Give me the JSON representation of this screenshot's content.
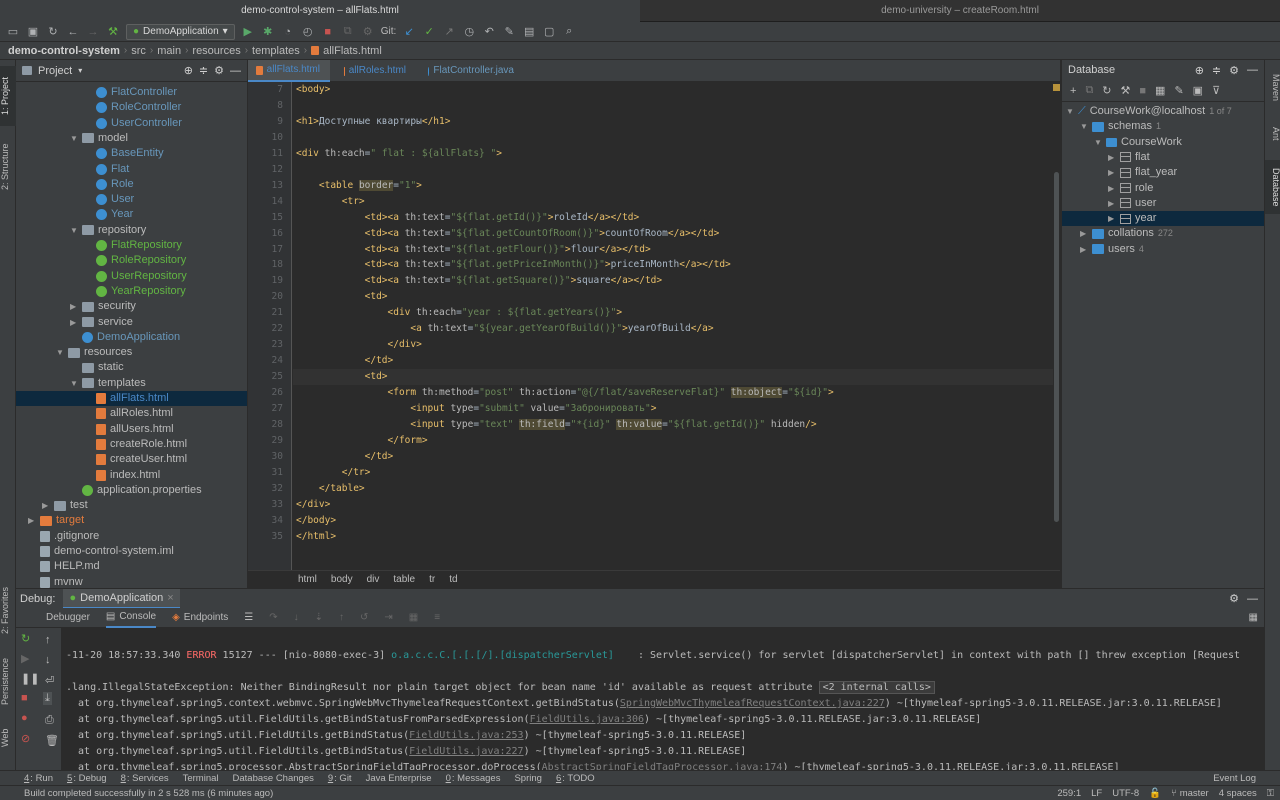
{
  "window": {
    "title_active": "demo-control-system – allFlats.html",
    "title_inactive": "demo-university – createRoom.html"
  },
  "toolbar": {
    "run_config": "DemoApplication",
    "git_label": "Git:"
  },
  "breadcrumbs": [
    "demo-control-system",
    "src",
    "main",
    "resources",
    "templates",
    "allFlats.html"
  ],
  "project_panel": {
    "title": "Project",
    "items": [
      {
        "label": "FlatController",
        "kind": "class",
        "depth": 4
      },
      {
        "label": "RoleController",
        "kind": "class",
        "depth": 4
      },
      {
        "label": "UserController",
        "kind": "class",
        "depth": 4
      },
      {
        "label": "model",
        "kind": "package",
        "depth": 3,
        "expanded": true
      },
      {
        "label": "BaseEntity",
        "kind": "class",
        "depth": 4
      },
      {
        "label": "Flat",
        "kind": "class",
        "depth": 4
      },
      {
        "label": "Role",
        "kind": "class",
        "depth": 4
      },
      {
        "label": "User",
        "kind": "class",
        "depth": 4
      },
      {
        "label": "Year",
        "kind": "class",
        "depth": 4
      },
      {
        "label": "repository",
        "kind": "package",
        "depth": 3,
        "expanded": true
      },
      {
        "label": "FlatRepository",
        "kind": "interface",
        "depth": 4
      },
      {
        "label": "RoleRepository",
        "kind": "interface",
        "depth": 4
      },
      {
        "label": "UserRepository",
        "kind": "interface",
        "depth": 4
      },
      {
        "label": "YearRepository",
        "kind": "interface",
        "depth": 4
      },
      {
        "label": "security",
        "kind": "package",
        "depth": 3,
        "expanded": false
      },
      {
        "label": "service",
        "kind": "package",
        "depth": 3,
        "expanded": false
      },
      {
        "label": "DemoApplication",
        "kind": "class",
        "depth": 3
      },
      {
        "label": "resources",
        "kind": "folder",
        "depth": 2,
        "expanded": true
      },
      {
        "label": "static",
        "kind": "folder",
        "depth": 3
      },
      {
        "label": "templates",
        "kind": "folder",
        "depth": 3,
        "expanded": true
      },
      {
        "label": "allFlats.html",
        "kind": "html",
        "depth": 4,
        "selected": true
      },
      {
        "label": "allRoles.html",
        "kind": "html",
        "depth": 4
      },
      {
        "label": "allUsers.html",
        "kind": "html",
        "depth": 4
      },
      {
        "label": "createRole.html",
        "kind": "html",
        "depth": 4
      },
      {
        "label": "createUser.html",
        "kind": "html",
        "depth": 4
      },
      {
        "label": "index.html",
        "kind": "html",
        "depth": 4
      },
      {
        "label": "application.properties",
        "kind": "props",
        "depth": 3
      },
      {
        "label": "test",
        "kind": "folder",
        "depth": 1,
        "expanded": false
      },
      {
        "label": "target",
        "kind": "excluded",
        "depth": 0,
        "expanded": false
      },
      {
        "label": ".gitignore",
        "kind": "file",
        "depth": 0
      },
      {
        "label": "demo-control-system.iml",
        "kind": "iml",
        "depth": 0
      },
      {
        "label": "HELP.md",
        "kind": "md",
        "depth": 0
      },
      {
        "label": "mvnw",
        "kind": "file",
        "depth": 0
      }
    ]
  },
  "editor": {
    "tabs": [
      {
        "label": "allFlats.html",
        "active": true
      },
      {
        "label": "allRoles.html",
        "active": false
      },
      {
        "label": "FlatController.java",
        "active": false
      }
    ],
    "first_line": 7,
    "current_line": 25,
    "lines": [
      [
        [
          "t",
          "<body>"
        ]
      ],
      [],
      [
        [
          "t",
          "<h1>"
        ],
        [
          "x",
          "Доступные квартиры"
        ],
        [
          "t",
          "</h1>"
        ]
      ],
      [],
      [
        [
          "t",
          "<div "
        ],
        [
          "a",
          "th:each"
        ],
        [
          "x",
          "="
        ],
        [
          "s",
          "\" flat : ${allFlats} \""
        ],
        [
          "t",
          ">"
        ]
      ],
      [],
      [
        [
          "x",
          "    "
        ],
        [
          "t",
          "<table "
        ],
        [
          "h",
          "border"
        ],
        [
          "x",
          "="
        ],
        [
          "s",
          "\"1\""
        ],
        [
          "t",
          ">"
        ]
      ],
      [
        [
          "x",
          "        "
        ],
        [
          "t",
          "<tr>"
        ]
      ],
      [
        [
          "x",
          "            "
        ],
        [
          "t",
          "<td><a "
        ],
        [
          "a",
          "th:text"
        ],
        [
          "x",
          "="
        ],
        [
          "s",
          "\"${flat.getId()}\""
        ],
        [
          "t",
          ">"
        ],
        [
          "x",
          "roleId"
        ],
        [
          "t",
          "</a></td>"
        ]
      ],
      [
        [
          "x",
          "            "
        ],
        [
          "t",
          "<td><a "
        ],
        [
          "a",
          "th:text"
        ],
        [
          "x",
          "="
        ],
        [
          "s",
          "\"${flat.getCountOfRoom()}\""
        ],
        [
          "t",
          ">"
        ],
        [
          "x",
          "countOfRoom"
        ],
        [
          "t",
          "</a></td>"
        ]
      ],
      [
        [
          "x",
          "            "
        ],
        [
          "t",
          "<td><a "
        ],
        [
          "a",
          "th:text"
        ],
        [
          "x",
          "="
        ],
        [
          "s",
          "\"${flat.getFlour()}\""
        ],
        [
          "t",
          ">"
        ],
        [
          "x",
          "flour"
        ],
        [
          "t",
          "</a></td>"
        ]
      ],
      [
        [
          "x",
          "            "
        ],
        [
          "t",
          "<td><a "
        ],
        [
          "a",
          "th:text"
        ],
        [
          "x",
          "="
        ],
        [
          "s",
          "\"${flat.getPriceInMonth()}\""
        ],
        [
          "t",
          ">"
        ],
        [
          "x",
          "priceInMonth"
        ],
        [
          "t",
          "</a></td>"
        ]
      ],
      [
        [
          "x",
          "            "
        ],
        [
          "t",
          "<td><a "
        ],
        [
          "a",
          "th:text"
        ],
        [
          "x",
          "="
        ],
        [
          "s",
          "\"${flat.getSquare()}\""
        ],
        [
          "t",
          ">"
        ],
        [
          "x",
          "square"
        ],
        [
          "t",
          "</a></td>"
        ]
      ],
      [
        [
          "x",
          "            "
        ],
        [
          "t",
          "<td>"
        ]
      ],
      [
        [
          "x",
          "                "
        ],
        [
          "t",
          "<div "
        ],
        [
          "a",
          "th:each"
        ],
        [
          "x",
          "="
        ],
        [
          "s",
          "\"year : ${flat.getYears()}\""
        ],
        [
          "t",
          ">"
        ]
      ],
      [
        [
          "x",
          "                    "
        ],
        [
          "t",
          "<a "
        ],
        [
          "a",
          "th:text"
        ],
        [
          "x",
          "="
        ],
        [
          "s",
          "\"${year.getYearOfBuild()}\""
        ],
        [
          "t",
          ">"
        ],
        [
          "x",
          "yearOfBuild"
        ],
        [
          "t",
          "</a>"
        ]
      ],
      [
        [
          "x",
          "                "
        ],
        [
          "t",
          "</div>"
        ]
      ],
      [
        [
          "x",
          "            "
        ],
        [
          "t",
          "</td>"
        ]
      ],
      [
        [
          "x",
          "            "
        ],
        [
          "t",
          "<td>"
        ]
      ],
      [
        [
          "x",
          "                "
        ],
        [
          "t",
          "<form "
        ],
        [
          "a",
          "th:method"
        ],
        [
          "x",
          "="
        ],
        [
          "s",
          "\"post\" "
        ],
        [
          "a",
          "th:action"
        ],
        [
          "x",
          "="
        ],
        [
          "s",
          "\"@{/flat/saveReserveFlat}\" "
        ],
        [
          "h",
          "th:object"
        ],
        [
          "x",
          "="
        ],
        [
          "s",
          "\"${id}\""
        ],
        [
          "t",
          ">"
        ]
      ],
      [
        [
          "x",
          "                    "
        ],
        [
          "t",
          "<input "
        ],
        [
          "a",
          "type"
        ],
        [
          "x",
          "="
        ],
        [
          "s",
          "\"submit\" "
        ],
        [
          "a",
          "value"
        ],
        [
          "x",
          "="
        ],
        [
          "s",
          "\"Забронировать\""
        ],
        [
          "t",
          ">"
        ]
      ],
      [
        [
          "x",
          "                    "
        ],
        [
          "t",
          "<input "
        ],
        [
          "a",
          "type"
        ],
        [
          "x",
          "="
        ],
        [
          "s",
          "\"text\" "
        ],
        [
          "h",
          "th:field"
        ],
        [
          "x",
          "="
        ],
        [
          "s",
          "\"*{id}\" "
        ],
        [
          "h",
          "th:value"
        ],
        [
          "x",
          "="
        ],
        [
          "s",
          "\"${flat.getId()}\" "
        ],
        [
          "a",
          "hidden"
        ],
        [
          "t",
          "/>"
        ]
      ],
      [
        [
          "x",
          "                "
        ],
        [
          "t",
          "</form>"
        ]
      ],
      [
        [
          "x",
          "            "
        ],
        [
          "t",
          "</td>"
        ]
      ],
      [
        [
          "x",
          "        "
        ],
        [
          "t",
          "</tr>"
        ]
      ],
      [
        [
          "x",
          "    "
        ],
        [
          "t",
          "</table>"
        ]
      ],
      [
        [
          "t",
          "</div>"
        ]
      ],
      [
        [
          "t",
          "</body>"
        ]
      ],
      [
        [
          "t",
          "</html>"
        ]
      ]
    ],
    "crumbs": [
      "html",
      "body",
      "div",
      "table",
      "tr",
      "td"
    ]
  },
  "database_panel": {
    "title": "Database",
    "items": [
      {
        "label": "CourseWork@localhost",
        "count": "1 of 7",
        "kind": "datasource",
        "depth": 0
      },
      {
        "label": "schemas",
        "count": "1",
        "kind": "folder",
        "depth": 1
      },
      {
        "label": "CourseWork",
        "count": "",
        "kind": "schema",
        "depth": 2
      },
      {
        "label": "flat",
        "count": "",
        "kind": "table",
        "depth": 3
      },
      {
        "label": "flat_year",
        "count": "",
        "kind": "table",
        "depth": 3
      },
      {
        "label": "role",
        "count": "",
        "kind": "table",
        "depth": 3
      },
      {
        "label": "user",
        "count": "",
        "kind": "table",
        "depth": 3
      },
      {
        "label": "year",
        "count": "",
        "kind": "table",
        "depth": 3,
        "selected": true
      },
      {
        "label": "collations",
        "count": "272",
        "kind": "folder",
        "depth": 1
      },
      {
        "label": "users",
        "count": "4",
        "kind": "folder",
        "depth": 1
      }
    ]
  },
  "left_stripe": [
    "1: Project",
    "2: Structure",
    "2: Favorites",
    "Persistence",
    "Web"
  ],
  "right_stripe": [
    "Maven",
    "Ant",
    "Database"
  ],
  "debug": {
    "label": "Debug:",
    "session": "DemoApplication",
    "tabs": [
      "Debugger",
      "Console",
      "Endpoints"
    ],
    "console": [
      [
        [
          "x",
          "-11-20 18:57:33.340 "
        ],
        [
          "e",
          "ERROR"
        ],
        [
          "x",
          " 15127 --- [nio-8080-exec-3] "
        ],
        [
          "c",
          "o.a.c.c.C.[.[.[/].[dispatcherServlet]"
        ],
        [
          "x",
          "    : Servlet.service() for servlet [dispatcherServlet] in context with path [] threw exception [Request"
        ]
      ],
      [],
      [
        [
          "x",
          ".lang.IllegalStateException: Neither BindingResult nor plain target object for bean name 'id' available as request attribute "
        ],
        [
          "f",
          "<2 internal calls>"
        ]
      ],
      [
        [
          "x",
          "  at org.thymeleaf.spring5.context.webmvc.SpringWebMvcThymeleafRequestContext.getBindStatus("
        ],
        [
          "l",
          "SpringWebMvcThymeleafRequestContext.java:227"
        ],
        [
          "x",
          ") ~[thymeleaf-spring5-3.0.11.RELEASE.jar:3.0.11.RELEASE]"
        ]
      ],
      [
        [
          "x",
          "  at org.thymeleaf.spring5.util.FieldUtils.getBindStatusFromParsedExpression("
        ],
        [
          "l",
          "FieldUtils.java:306"
        ],
        [
          "x",
          ") ~[thymeleaf-spring5-3.0.11.RELEASE.jar:3.0.11.RELEASE]"
        ]
      ],
      [
        [
          "x",
          "  at org.thymeleaf.spring5.util.FieldUtils.getBindStatus("
        ],
        [
          "l",
          "FieldUtils.java:253"
        ],
        [
          "x",
          ") ~[thymeleaf-spring5-3.0.11.RELEASE]"
        ]
      ],
      [
        [
          "x",
          "  at org.thymeleaf.spring5.util.FieldUtils.getBindStatus("
        ],
        [
          "l",
          "FieldUtils.java:227"
        ],
        [
          "x",
          ") ~[thymeleaf-spring5-3.0.11.RELEASE]"
        ]
      ],
      [
        [
          "x",
          "  at org.thymeleaf.spring5.processor.AbstractSpringFieldTagProcessor.doProcess("
        ],
        [
          "l",
          "AbstractSpringFieldTagProcessor.java:174"
        ],
        [
          "x",
          ") ~[thymeleaf-spring5-3.0.11.RELEASE.jar:3.0.11.RELEASE]"
        ]
      ]
    ]
  },
  "tool_windows": [
    {
      "num": "4",
      "label": ": Run"
    },
    {
      "num": "5",
      "label": ": Debug"
    },
    {
      "num": "8",
      "label": ": Services"
    },
    {
      "num": "",
      "label": "Terminal"
    },
    {
      "num": "",
      "label": "Database Changes"
    },
    {
      "num": "9",
      "label": ": Git"
    },
    {
      "num": "",
      "label": "Java Enterprise"
    },
    {
      "num": "0",
      "label": ": Messages"
    },
    {
      "num": "",
      "label": "Spring"
    },
    {
      "num": "6",
      "label": ": TODO"
    }
  ],
  "event_log": "Event Log",
  "status": {
    "message": "Build completed successfully in 2 s 528 ms (6 minutes ago)",
    "position": "259:1",
    "line_sep": "LF",
    "encoding": "UTF-8",
    "branch": "master",
    "indent": "4 spaces"
  }
}
